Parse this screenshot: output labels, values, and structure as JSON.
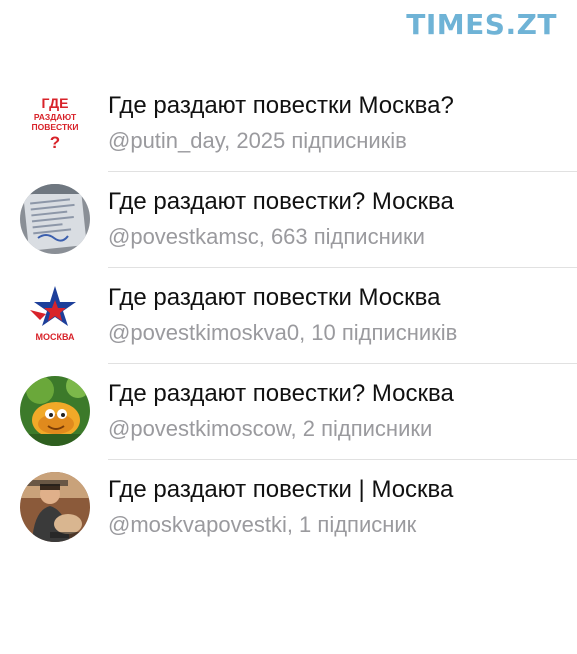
{
  "watermark": "TIMES.ZT",
  "channels": [
    {
      "title": "Где раздают повестки Москва?",
      "subtitle": "@putin_day, 2025 підписників",
      "avatar": {
        "icon": "text-logo-icon",
        "lines": [
          "ГДЕ",
          "РАЗДАЮТ",
          "ПОВЕСТКИ",
          "?"
        ],
        "color": "#d8232a"
      }
    },
    {
      "title": "Где раздают повестки? Москва",
      "subtitle": "@povestkamsc, 663 підписники",
      "avatar": {
        "icon": "document-photo-icon"
      }
    },
    {
      "title": "Где раздают повестки Москва",
      "subtitle": "@povestkimoskva0, 10 підписників",
      "avatar": {
        "icon": "star-logo-icon",
        "caption": "МОСКВА",
        "colors": {
          "blue": "#1d3f9a",
          "red": "#d8232a"
        }
      }
    },
    {
      "title": "Где раздают повестки? Москва",
      "subtitle": "@povestkimoscow, 2 підписники",
      "avatar": {
        "icon": "cartoon-character-icon"
      }
    },
    {
      "title": "Где раздают повестки | Москва",
      "subtitle": "@moskvapovestki, 1 підписник",
      "avatar": {
        "icon": "person-photo-icon"
      }
    }
  ]
}
